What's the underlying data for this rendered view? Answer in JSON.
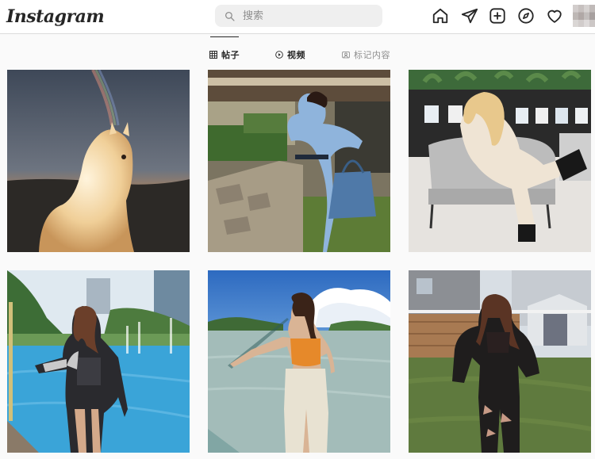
{
  "header": {
    "logo_text": "Instagram",
    "search_placeholder": "搜索",
    "nav_icons": [
      "home-icon",
      "direct-send-icon",
      "new-post-icon",
      "explore-icon",
      "activity-heart-icon"
    ],
    "avatar": "profile-avatar"
  },
  "tabs": [
    {
      "label": "帖子",
      "icon": "grid-icon",
      "active": true
    },
    {
      "label": "视频",
      "icon": "play-icon",
      "active": false
    },
    {
      "label": "标记内容",
      "icon": "tagged-icon",
      "active": false
    }
  ],
  "posts": [
    {
      "subject": "white-dog-with-rainbow",
      "colors": {
        "sky": "#4a5666",
        "ground": "#2b2a28",
        "accent": "#f0c88a"
      }
    },
    {
      "subject": "woman-in-blue-dress-with-bag",
      "colors": {
        "sky": "#6a6a5a",
        "dress": "#8fb4dc",
        "bag": "#4f79a8"
      }
    },
    {
      "subject": "woman-on-grey-chair",
      "colors": {
        "wall": "#2e2e2e",
        "chair": "#bdbdbd",
        "outfit": "#eadfd0"
      }
    },
    {
      "subject": "woman-by-pool-with-jacket",
      "colors": {
        "sky": "#dce8f0",
        "water": "#3aa4d8",
        "jacket": "#2a2a2e"
      }
    },
    {
      "subject": "woman-orange-top-waterfront",
      "colors": {
        "sky": "#3d78c4",
        "water": "#9fb7b6",
        "top": "#e68a2c"
      }
    },
    {
      "subject": "woman-in-backyard-black-outfit",
      "colors": {
        "sky": "#d6dde4",
        "grass": "#5f7a3e",
        "fence": "#a07650"
      }
    }
  ]
}
